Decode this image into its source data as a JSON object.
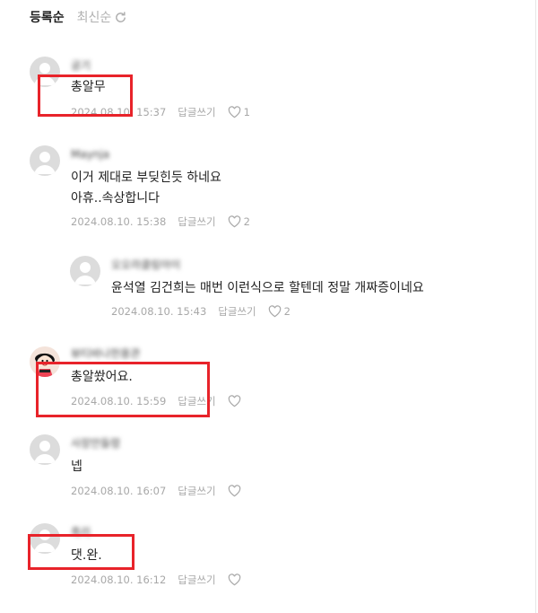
{
  "sort": {
    "active": "등록순",
    "inactive": "최신순",
    "refresh_icon": "refresh-icon"
  },
  "comments": [
    {
      "nickname": "궁기",
      "text": "총알무",
      "date": "2024.08.10. 15:37",
      "reply": "답글쓰기",
      "likes": "1"
    },
    {
      "nickname": "Maynja",
      "text": "이거 제대로 부딪힌듯 하네요\n아휴..속상합니다",
      "date": "2024.08.10. 15:38",
      "reply": "답글쓰기",
      "likes": "2"
    },
    {
      "nickname": "오오라클링아이",
      "text": "윤석열 김건희는 매번 이런식으로 할텐데 정말 개짜증이네요",
      "date": "2024.08.10. 15:43",
      "reply": "답글쓰기",
      "likes": "2"
    },
    {
      "nickname": "뷰티바나헌용관",
      "text": "총알쐈어요.",
      "date": "2024.08.10. 15:59",
      "reply": "답글쓰기",
      "likes": ""
    },
    {
      "nickname": "사장만들령",
      "text": "넵",
      "date": "2024.08.10. 16:07",
      "reply": "답글쓰기",
      "likes": ""
    },
    {
      "nickname": "흑리",
      "text": "댓.완.",
      "date": "2024.08.10. 16:12",
      "reply": "답글쓰기",
      "likes": ""
    }
  ],
  "colors": {
    "highlight": "#e8232a",
    "meta": "#a8a8a8",
    "avatar": "#dcdcdc"
  }
}
